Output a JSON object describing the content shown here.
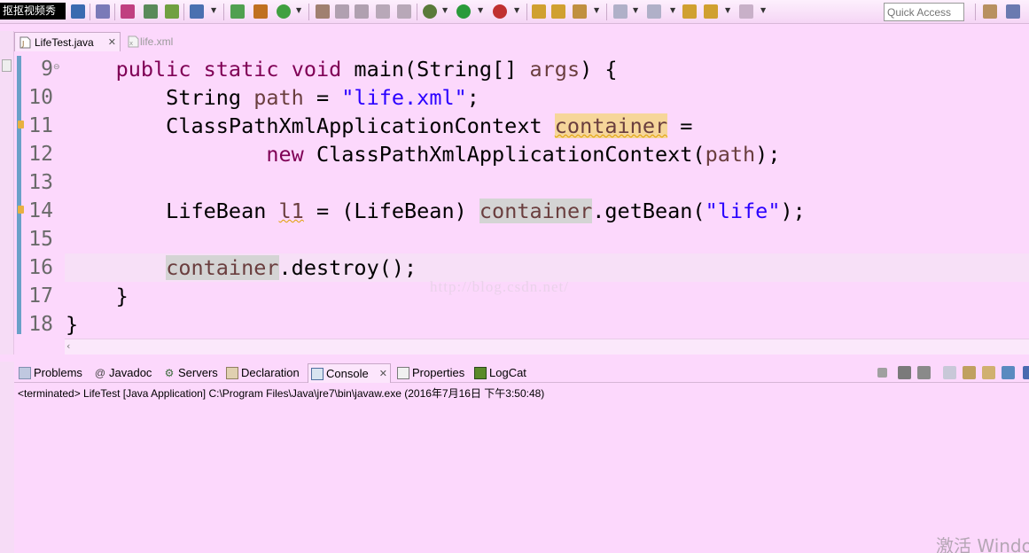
{
  "toolbar": {
    "watermark_label": "抠抠视频秀",
    "quick_access_placeholder": "Quick Access"
  },
  "editor_tabs": [
    {
      "label": "LifeTest.java",
      "active": true,
      "icon": "java-file-icon"
    },
    {
      "label": "life.xml",
      "active": false,
      "icon": "xml-file-icon"
    }
  ],
  "code": {
    "line_numbers": [
      "9",
      "10",
      "11",
      "12",
      "13",
      "14",
      "15",
      "16",
      "17",
      "18"
    ],
    "current_line": "16",
    "highlighted_identifier": "container"
  },
  "editor_watermark": "http://blog.csdn.net/",
  "views": {
    "tabs": [
      {
        "label": "Problems",
        "icon": "problems-icon"
      },
      {
        "label": "Javadoc",
        "icon": "javadoc-icon"
      },
      {
        "label": "Servers",
        "icon": "servers-icon"
      },
      {
        "label": "Declaration",
        "icon": "declaration-icon"
      },
      {
        "label": "Console",
        "icon": "console-icon",
        "active": true
      },
      {
        "label": "Properties",
        "icon": "properties-icon"
      },
      {
        "label": "LogCat",
        "icon": "logcat-icon"
      }
    ]
  },
  "console": {
    "status": "<terminated> LifeTest [Java Application] C:\\Program Files\\Java\\jre7\\bin\\javaw.exe (2016年7月16日 下午3:50:48)"
  },
  "os_watermark": "激活 Windo",
  "colors": {
    "background": "#fcd8fc",
    "keyword": "#7f0055",
    "string": "#2a00ff",
    "local_variable": "#6a3e3e",
    "write_occurrence": "#f6d69a",
    "read_occurrence": "#d4d4d4"
  }
}
